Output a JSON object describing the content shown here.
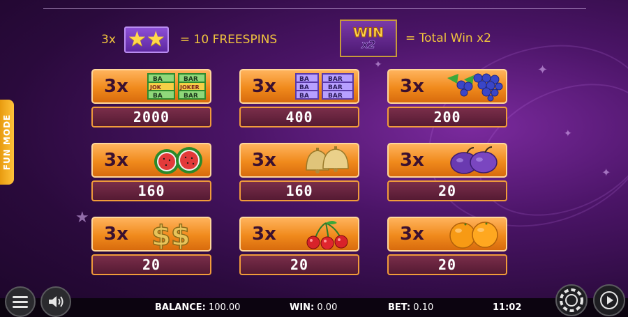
{
  "header": {
    "freespins_count": "3x",
    "freespins_text": "= 10 FREESPINS",
    "win_logo_word": "WIN",
    "win_logo_mult": "x2",
    "win_text": "= Total Win x2"
  },
  "tiles": [
    {
      "qty": "3x",
      "symbol": "bar-joker-icon",
      "payout": "2000"
    },
    {
      "qty": "3x",
      "symbol": "bar-icon",
      "payout": "400"
    },
    {
      "qty": "3x",
      "symbol": "grapes-icon",
      "payout": "200"
    },
    {
      "qty": "3x",
      "symbol": "watermelon-icon",
      "payout": "160"
    },
    {
      "qty": "3x",
      "symbol": "bells-icon",
      "payout": "160"
    },
    {
      "qty": "3x",
      "symbol": "plums-icon",
      "payout": "20"
    },
    {
      "qty": "3x",
      "symbol": "dollar-icon",
      "payout": "20"
    },
    {
      "qty": "3x",
      "symbol": "cherries-icon",
      "payout": "20"
    },
    {
      "qty": "3x",
      "symbol": "oranges-icon",
      "payout": "20"
    }
  ],
  "symbol_text": {
    "bar": "BAR",
    "bar_short": "BA",
    "joker": "JOKER",
    "joker_short": "JOK",
    "dollar": "$$"
  },
  "fun_mode": "FUN MODE",
  "status": {
    "balance_label": "BALANCE:",
    "balance_value": "100.00",
    "win_label": "WIN:",
    "win_value": "0.00",
    "bet_label": "BET:",
    "bet_value": "0.10",
    "clock": "11:02"
  },
  "colors": {
    "accent_gold": "#f2c53d",
    "tile_orange": "#f08a1c",
    "payout_plum": "#551a33",
    "background_purple": "#4a1466"
  }
}
